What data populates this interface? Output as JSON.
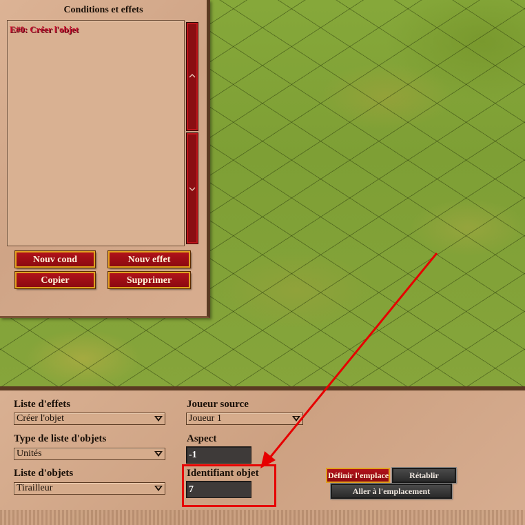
{
  "top_panel": {
    "title": "Conditions et effets",
    "list_items": [
      "E#0: Créer l'objet"
    ],
    "buttons": {
      "new_condition": "Nouv cond",
      "new_effect": "Nouv effet",
      "copy": "Copier",
      "delete": "Supprimer"
    }
  },
  "effect_editor": {
    "effect_list": {
      "label": "Liste d'effets",
      "value": "Créer l'objet"
    },
    "object_list_type": {
      "label": "Type de liste d'objets",
      "value": "Unités"
    },
    "object_list": {
      "label": "Liste d'objets",
      "value": "Tirailleur"
    },
    "source_player": {
      "label": "Joueur source",
      "value": "Joueur 1"
    },
    "aspect": {
      "label": "Aspect",
      "value": "-1"
    },
    "object_id": {
      "label": "Identifiant objet",
      "value": "7"
    },
    "buttons": {
      "set_location": "Définir l'emplacement",
      "reset": "Rétablir",
      "go_to_location": "Aller à l'emplacement"
    }
  },
  "icons": [
    "chevron-up-icon",
    "chevron-down-icon",
    "dropdown-arrow-icon"
  ],
  "colors": {
    "highlight": "#e60000",
    "list_item_text": "#c8102e",
    "button_red": "#a00f16",
    "button_border": "#e0a020"
  }
}
